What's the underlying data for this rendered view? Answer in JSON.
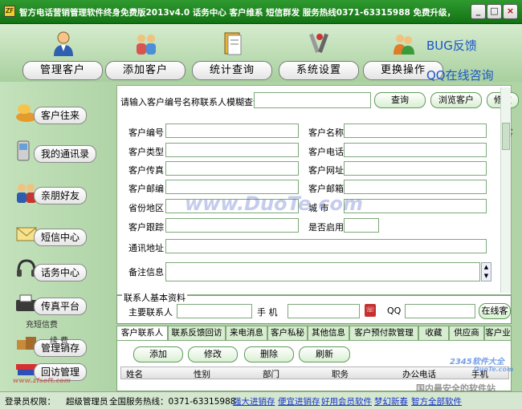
{
  "window": {
    "title": "智方电话营销管理软件终身免费版2013v4.0  话务中心 客户维系 短信群发  服务热线0371-63315988 免费升级，",
    "btn_min": "_",
    "btn_max": "□",
    "btn_close": "×"
  },
  "toolbar": {
    "items": [
      {
        "label": "管理客户",
        "icon": "person-icon"
      },
      {
        "label": "添加客户",
        "icon": "people-icon"
      },
      {
        "label": "统计查询",
        "icon": "binder-icon"
      },
      {
        "label": "系统设置",
        "icon": "tools-icon"
      },
      {
        "label": "更换操作",
        "icon": "users-icon"
      }
    ],
    "bug_feedback": "BUG反馈",
    "qq_consult": "QQ在线咨询"
  },
  "sidebar": {
    "items": [
      {
        "label": "客户往来"
      },
      {
        "label": "我的通讯录"
      },
      {
        "label": "亲朋好友"
      },
      {
        "label": "短信中心"
      },
      {
        "label": "话务中心"
      },
      {
        "label": "传真平台"
      },
      {
        "label": "管理销存"
      },
      {
        "label": "回访管理"
      }
    ],
    "overlay_text_1": "充短信费",
    "overlay_text_2": "续   费"
  },
  "search": {
    "label": "请输入客户编号名称联系人模糊查询",
    "value": "",
    "btn_query": "查询",
    "btn_browse": "浏览客户",
    "btn_modify": "修改"
  },
  "form": {
    "customer_id": "客户编号",
    "customer_name": "客户名称",
    "customer_type": "客户类型",
    "customer_phone": "客户电话",
    "customer_fax": "客户传真",
    "customer_website": "客户网址",
    "customer_zip": "客户邮编",
    "customer_email": "客户邮箱",
    "province": "省份地区",
    "city": "城  市",
    "customer_followup": "客户跟踪",
    "enabled": "是否启用",
    "address": "通讯地址",
    "remarks": "备注信息",
    "right_clip": "客"
  },
  "contact": {
    "group_title": "联系人基本资料",
    "primary_contact": "主要联系人",
    "mobile": "手  机",
    "qq": "QQ",
    "online_btn": "在线客"
  },
  "tabs": [
    "客户联系人",
    "联系反馈回访",
    "来电消息",
    "客户私秘",
    "其他信息",
    "客户预付款管理",
    "收藏",
    "供应商",
    "客户业"
  ],
  "actions": {
    "add": "添加",
    "modify": "修改",
    "delete": "删除",
    "refresh": "刷新"
  },
  "table": {
    "columns": [
      "姓名",
      "性别",
      "部门",
      "职务",
      "办公电话",
      "手机"
    ]
  },
  "statusbar": {
    "login_perm": "登录员权限：",
    "role": "超级管理员",
    "hotline": "全国服务热线：0371-63315988",
    "links": [
      "强大进销存",
      "便宜进销存",
      "好用会员软件",
      "梦幻新春",
      "智方全部软件"
    ]
  },
  "watermarks": {
    "duote": "www.DuoTe.com",
    "site": "国内最安全的软件站",
    "brand": "2345软件大全",
    "brand_sub": "DuoTe.com",
    "small": "www.zfsoft.com"
  },
  "colors": {
    "titlebar": "#1e8a1e",
    "background": "#b9d8b1",
    "link": "#1633c8",
    "promo": "#1a56c8"
  }
}
